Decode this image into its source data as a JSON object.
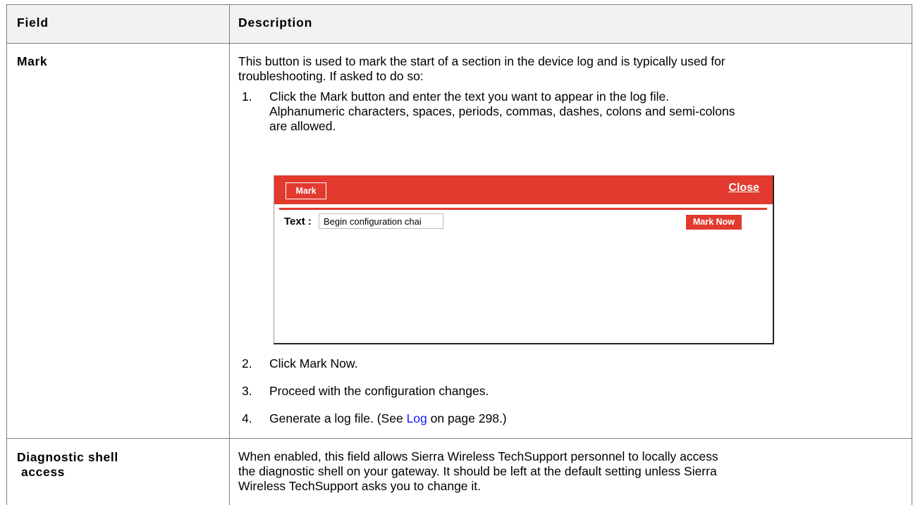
{
  "table": {
    "headers": {
      "field": "Field",
      "description": "Description"
    },
    "rows": [
      {
        "field": "Mark",
        "intro_line1": "This button is used to mark the start of a section in the device log and is typically used for",
        "intro_line2": "troubleshooting. If asked to do so:",
        "steps": [
          {
            "num": "1.",
            "line1": "Click the Mark button and enter the text you want to appear in the log file.",
            "line2": "Alphanumeric characters, spaces, periods, commas, dashes, colons and semi-colons",
            "line3": "are allowed."
          },
          {
            "num": "2.",
            "text": "Click Mark Now."
          },
          {
            "num": "3.",
            "text": "Proceed with the configuration changes."
          },
          {
            "num": "4.",
            "prefix": "Generate a log file. (See ",
            "link": "Log",
            "suffix": " on page 298.)"
          }
        ]
      },
      {
        "field_line1": "Diagnostic shell",
        "field_line2": "access",
        "line1": "When enabled, this field allows Sierra Wireless TechSupport personnel to locally access",
        "line2": "the diagnostic shell on your gateway. It should be left at the default setting unless Sierra",
        "line3": "Wireless TechSupport asks you to change it."
      }
    ]
  },
  "dialog": {
    "tab_label": "Mark",
    "close_label": "Close",
    "text_label": "Text :",
    "input_value": "Begin configuration chai",
    "mark_now_label": "Mark Now",
    "accent_color": "#e23a2f"
  }
}
